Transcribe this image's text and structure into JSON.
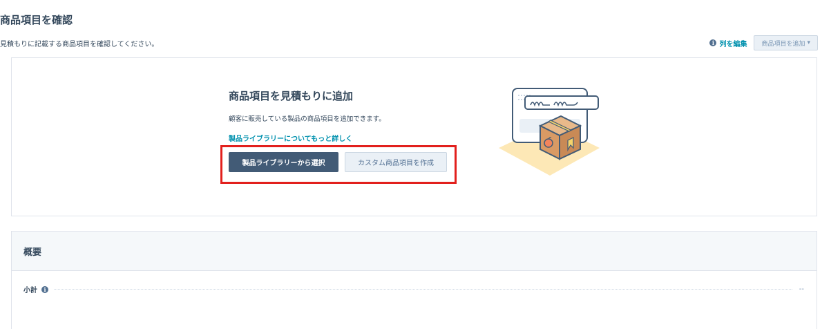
{
  "header": {
    "title": "商品項目を確認",
    "subtitle": "見積もりに記載する商品項目を確認してください。",
    "edit_columns_label": "列を編集",
    "add_item_dropdown_label": "商品項目を追加",
    "add_item_dropdown_caret": "▾"
  },
  "empty_state": {
    "heading": "商品項目を見積もりに追加",
    "description": "顧客に販売している製品の商品項目を追加できます。",
    "learn_more_link": "製品ライブラリーについてもっと詳しく",
    "primary_button": "製品ライブラリーから選択",
    "secondary_button": "カスタム商品項目を作成"
  },
  "summary": {
    "title": "概要",
    "subtotal_label": "小計",
    "subtotal_value": "--"
  },
  "icons": {
    "info": "info-icon",
    "illustration": "product-box-illustration"
  },
  "colors": {
    "accent_link": "#0091ae",
    "primary_button": "#425b76",
    "highlight": "#e2201d"
  }
}
